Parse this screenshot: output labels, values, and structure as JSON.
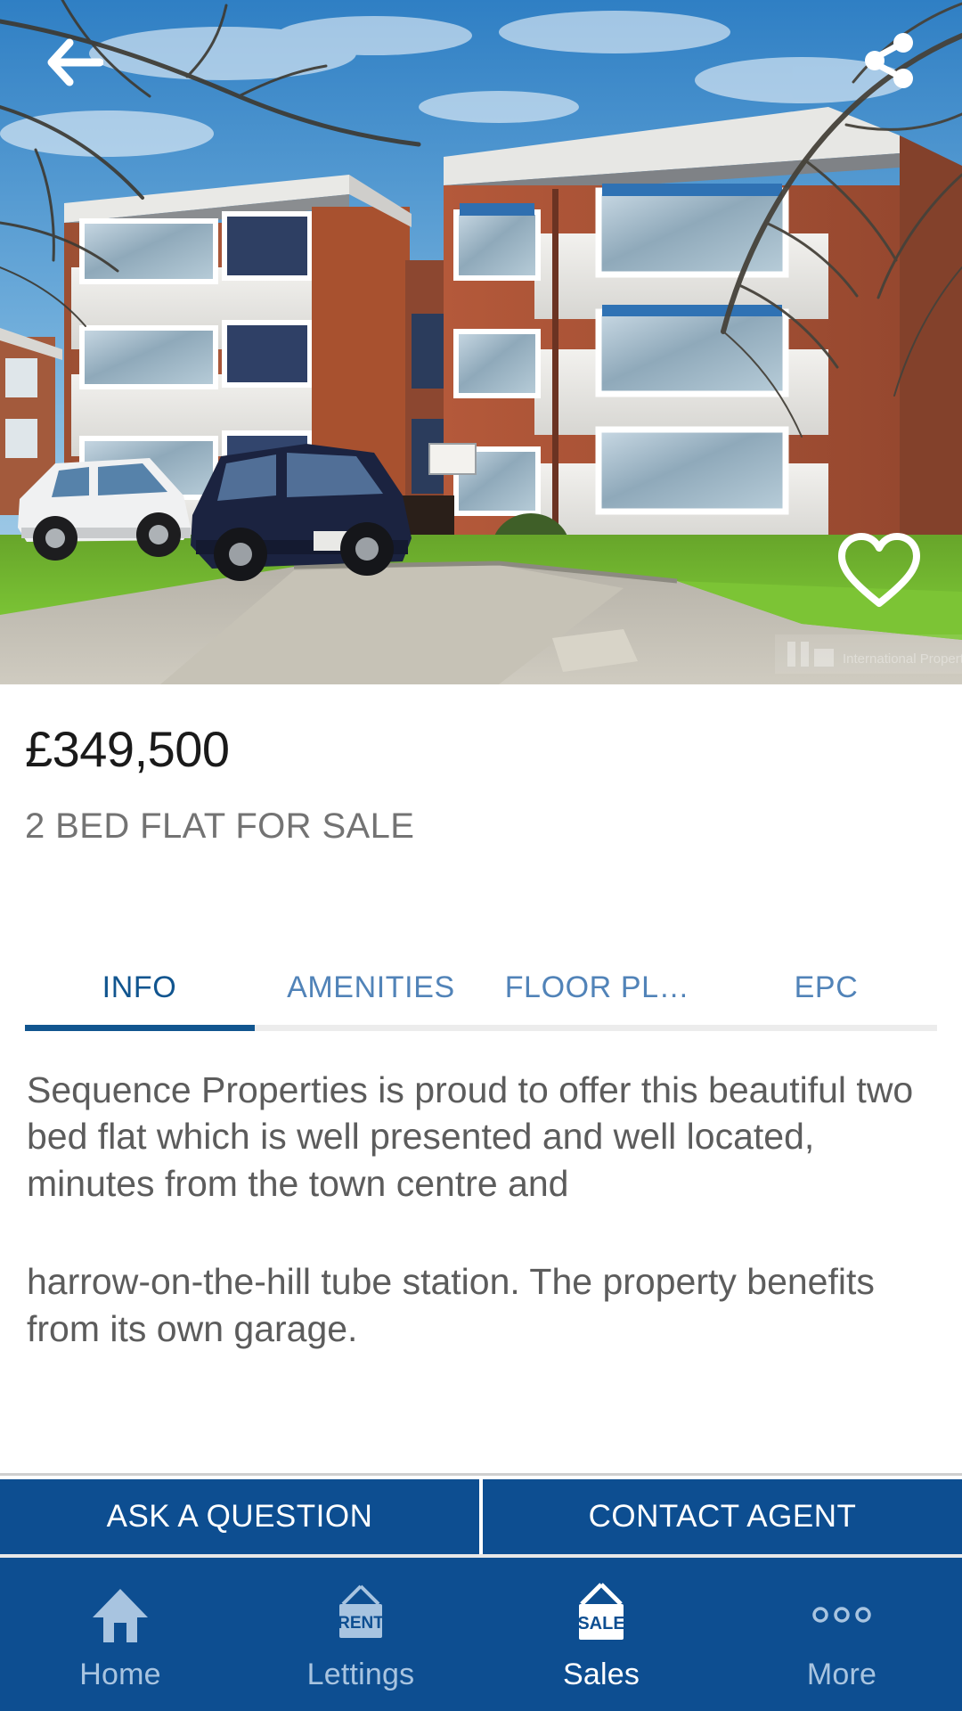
{
  "header": {
    "back_icon": "arrow-left-icon",
    "share_icon": "share-icon",
    "favorite_icon": "heart-outline-icon",
    "watermark": "International Property Bureau"
  },
  "listing": {
    "price": "£349,500",
    "subtitle": "2 BED FLAT FOR SALE"
  },
  "tabs": {
    "items": [
      {
        "label": "INFO",
        "active": true
      },
      {
        "label": "AMENITIES",
        "active": false
      },
      {
        "label": "FLOOR PL…",
        "active": false
      },
      {
        "label": "EPC",
        "active": false
      }
    ],
    "active_color": "#11558f",
    "inactive_color": "#5183b8"
  },
  "description": {
    "paragraphs": [
      "Sequence Properties is proud to offer this beautiful two bed flat which is well presented and well located, minutes from the town centre and",
      "harrow-on-the-hill tube station. The property benefits from its own garage."
    ]
  },
  "actions": {
    "ask_label": "ASK A QUESTION",
    "contact_label": "CONTACT AGENT",
    "button_color": "#0d4e91"
  },
  "bottom_nav": {
    "items": [
      {
        "label": "Home",
        "icon": "house-icon",
        "active": false
      },
      {
        "label": "Lettings",
        "icon": "rent-sign-icon",
        "active": false,
        "sign_text": "RENT"
      },
      {
        "label": "Sales",
        "icon": "sale-sign-icon",
        "active": true,
        "sign_text": "SALE"
      },
      {
        "label": "More",
        "icon": "ellipsis-icon",
        "active": false
      }
    ],
    "background": "#0d4e91"
  }
}
